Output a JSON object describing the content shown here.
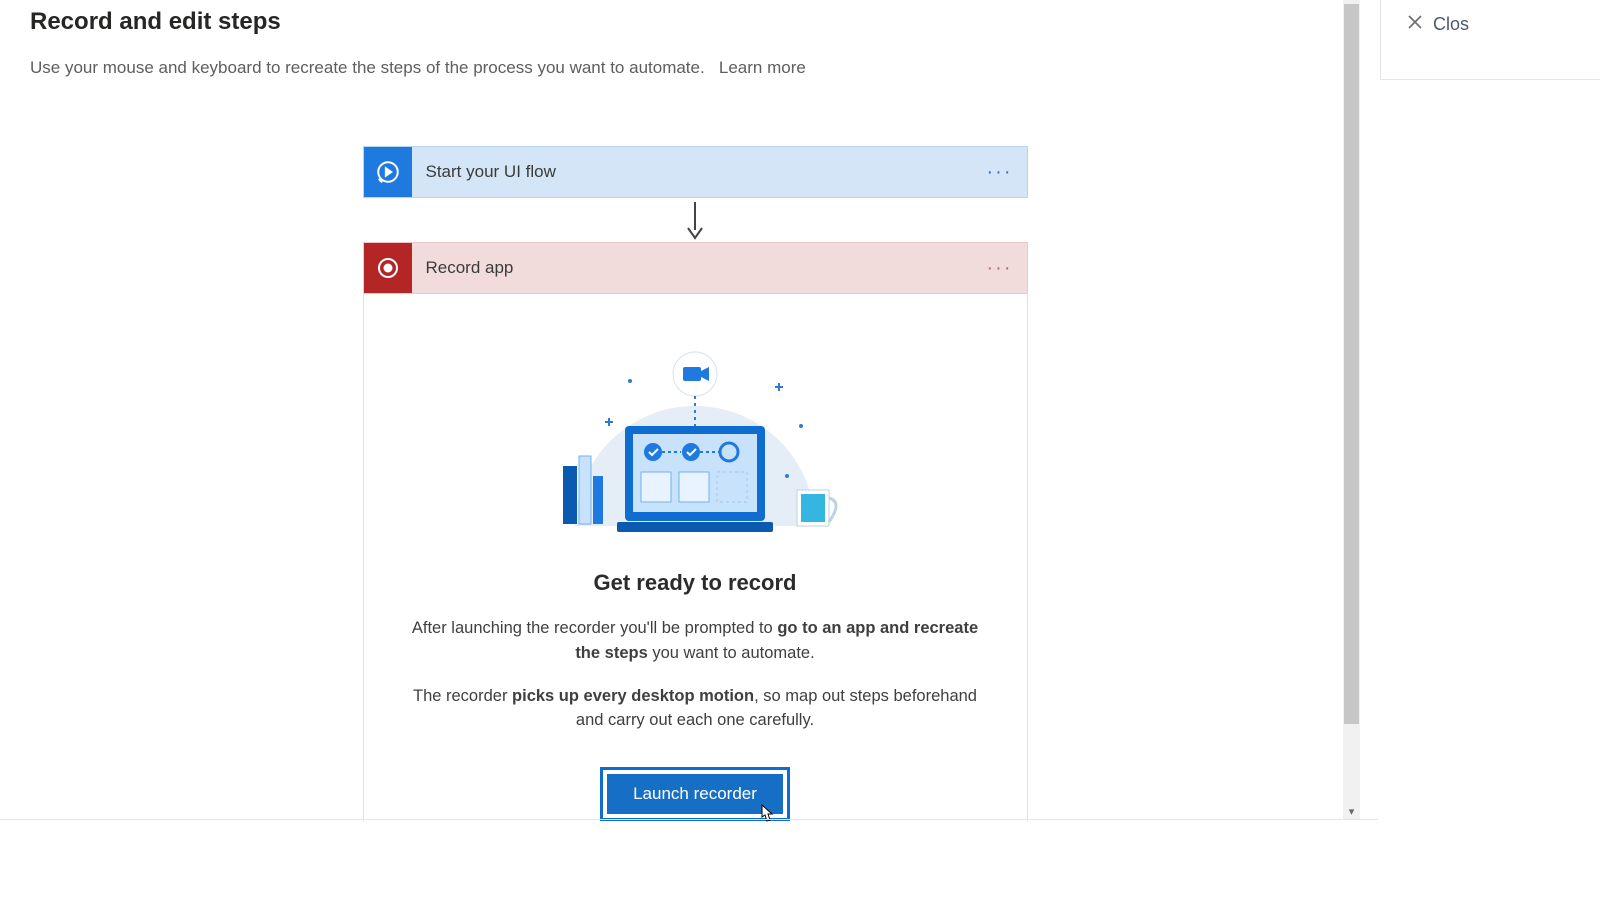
{
  "page": {
    "title": "Record and edit steps",
    "subtitle": "Use your mouse and keyboard to recreate the steps of the process you want to automate.",
    "learn_more": "Learn more"
  },
  "steps": {
    "start_flow": {
      "label": "Start your UI flow"
    },
    "record_app": {
      "label": "Record app"
    }
  },
  "record_panel": {
    "heading": "Get ready to record",
    "p1_pre": "After launching the recorder you'll be prompted to ",
    "p1_bold": "go to an app and recreate the steps",
    "p1_post": " you want to automate.",
    "p2_pre": "The recorder ",
    "p2_bold": "picks up every desktop motion",
    "p2_post": ", so map out steps beforehand and carry out each one carefully.",
    "launch_btn": "Launch recorder"
  },
  "side": {
    "close_label": "Clos"
  },
  "colors": {
    "accent_blue": "#1f7ae0",
    "accent_red": "#b42626"
  }
}
